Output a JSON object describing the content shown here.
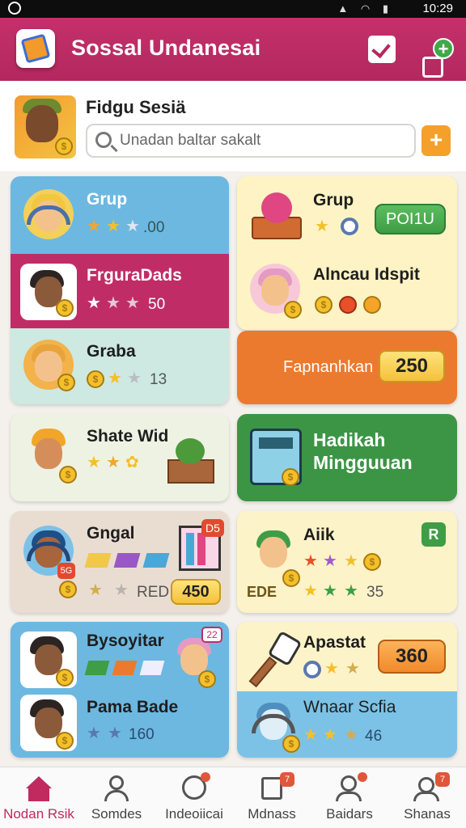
{
  "statusbar": {
    "time": "10:29"
  },
  "appbar": {
    "title": "Sossal Undanesai"
  },
  "profile": {
    "name": "Fidgu Sesiä",
    "search_placeholder": "Unadan baltar sakalt"
  },
  "cards": {
    "c1": {
      "title": "Grup",
      "value": ".00"
    },
    "c2": {
      "title": "FrguraDads",
      "value": "50"
    },
    "c3": {
      "title": "Graba",
      "value": "13"
    },
    "c4": {
      "title": "Grup",
      "button": "POI1U"
    },
    "c5": {
      "title": "Alncau Idspit"
    },
    "c6": {
      "label": "Fapnanhkan",
      "value": "250"
    },
    "c7": {
      "title": "Shate Wid"
    },
    "c8": {
      "title": "Hadikah Mingguuan"
    },
    "c9": {
      "title": "Gngal",
      "badge": "D5",
      "tag": "RED",
      "value": "450",
      "corner": "5G"
    },
    "c10": {
      "title": "Aiik",
      "badge": "R",
      "suffix": "35",
      "side": "ЕDE"
    },
    "c11": {
      "title": "Bysoyitar",
      "badge": "22",
      "title2": "Pama Bade",
      "value2": "160"
    },
    "c12": {
      "title": "Apastat",
      "value": "360",
      "title2": "Wnaar Scfia",
      "value2": "46"
    }
  },
  "nav": [
    {
      "label": "Nodan Rsik",
      "active": true
    },
    {
      "label": "Somdes"
    },
    {
      "label": "Indeoiicai"
    },
    {
      "label": "Mdnass"
    },
    {
      "label": "Baidars"
    },
    {
      "label": "Shanas"
    }
  ],
  "colors": {
    "brand": "#b3285f",
    "green": "#3f9d45",
    "orange": "#ec7a2e",
    "gold": "#f5c13b"
  }
}
